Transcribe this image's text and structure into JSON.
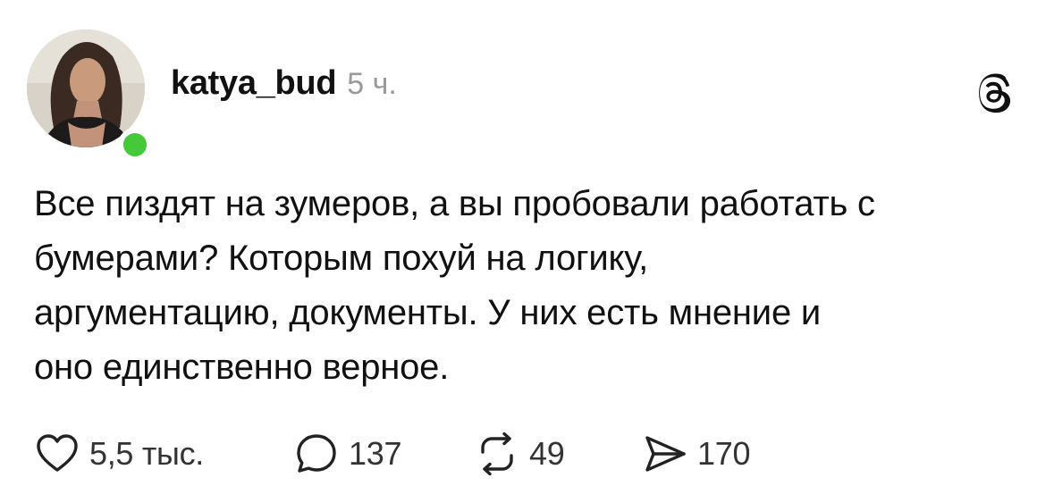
{
  "post": {
    "username": "katya_bud",
    "timestamp": "5 ч.",
    "body_lines": [
      "Все пиздят на зумеров, а вы пробовали работать с",
      "бумерами? Которым похуй на логику,",
      "аргументацию, документы. У них есть мнение и",
      "оно единственно верное."
    ],
    "actions": {
      "likes": "5,5 тыс.",
      "replies": "137",
      "reposts": "49",
      "shares": "170"
    }
  },
  "icons": {
    "logo": "threads-logo-icon",
    "like": "heart-icon",
    "reply": "comment-bubble-icon",
    "repost": "repost-arrows-icon",
    "share": "send-icon"
  },
  "colors": {
    "online": "#45c93a",
    "timestamp": "#9a9a9a",
    "text": "#111111"
  }
}
